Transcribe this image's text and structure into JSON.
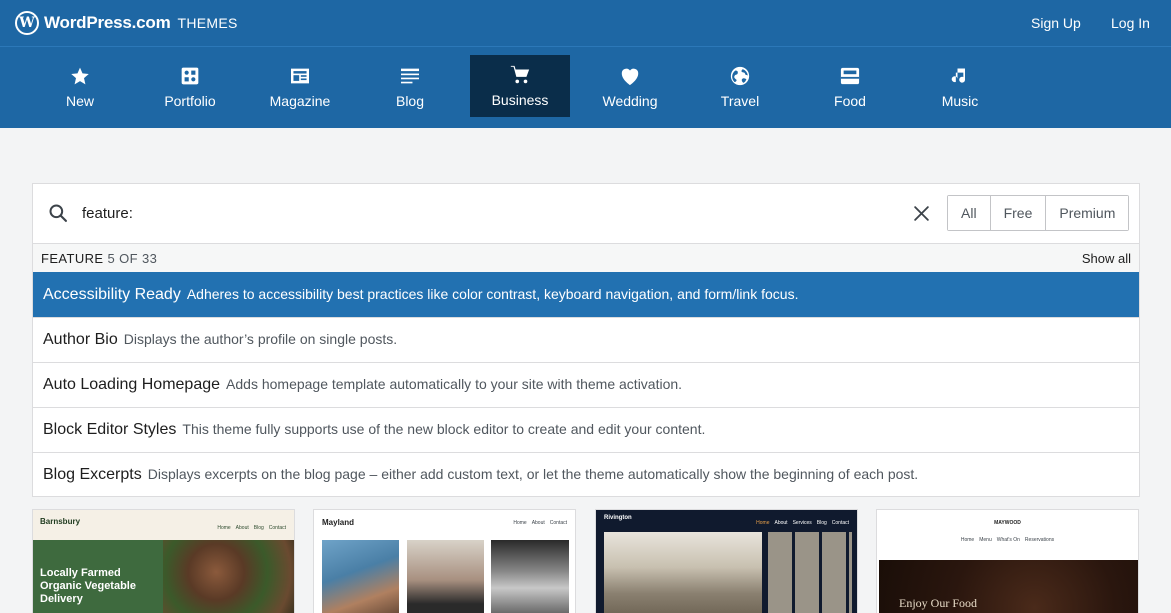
{
  "header": {
    "brand": "WordPress.com",
    "brand_sub": "THEMES",
    "logo_letter": "W",
    "sign_up": "Sign Up",
    "log_in": "Log In"
  },
  "categories": [
    {
      "label": "New",
      "icon": "star-icon"
    },
    {
      "label": "Portfolio",
      "icon": "image-grid-icon"
    },
    {
      "label": "Magazine",
      "icon": "newspaper-icon"
    },
    {
      "label": "Blog",
      "icon": "posts-icon"
    },
    {
      "label": "Business",
      "icon": "cart-icon",
      "active": true
    },
    {
      "label": "Wedding",
      "icon": "heart-icon"
    },
    {
      "label": "Travel",
      "icon": "globe-icon"
    },
    {
      "label": "Food",
      "icon": "food-icon"
    },
    {
      "label": "Music",
      "icon": "music-note-icon"
    }
  ],
  "search": {
    "value": "feature:",
    "filters": [
      "All",
      "Free",
      "Premium"
    ]
  },
  "features": {
    "heading": "FEATURE",
    "count": "5 OF 33",
    "show_all": "Show all",
    "items": [
      {
        "name": "Accessibility Ready",
        "desc": "Adheres to accessibility best practices like color contrast, keyboard navigation, and form/link focus."
      },
      {
        "name": "Author Bio",
        "desc": "Displays the author’s profile on single posts."
      },
      {
        "name": "Auto Loading Homepage",
        "desc": "Adds homepage template automatically to your site with theme activation."
      },
      {
        "name": "Block Editor Styles",
        "desc": "This theme fully supports use of the new block editor to create and edit your content."
      },
      {
        "name": "Blog Excerpts",
        "desc": "Displays excerpts on the blog page – either add custom text, or let the theme automatically show the beginning of each post."
      }
    ]
  },
  "themes": [
    {
      "name": "Barnsbury",
      "headline": "Locally Farmed Organic Vegetable Delivery",
      "nav": [
        "Home",
        "About",
        "Blog",
        "Contact"
      ]
    },
    {
      "name": "Mayland",
      "nav": [
        "Home",
        "About",
        "Contact"
      ]
    },
    {
      "name": "Rivington",
      "nav": [
        "Home",
        "About",
        "Services",
        "Blog",
        "Contact"
      ]
    },
    {
      "name": "MAYWOOD",
      "headline": "Enjoy Our Food",
      "nav": [
        "Home",
        "Menu",
        "What's On",
        "Reservations"
      ]
    }
  ],
  "colors": {
    "header_bg": "#1e67a4",
    "active_category_bg": "#0a2d4a",
    "selected_row_bg": "#2271b1"
  }
}
